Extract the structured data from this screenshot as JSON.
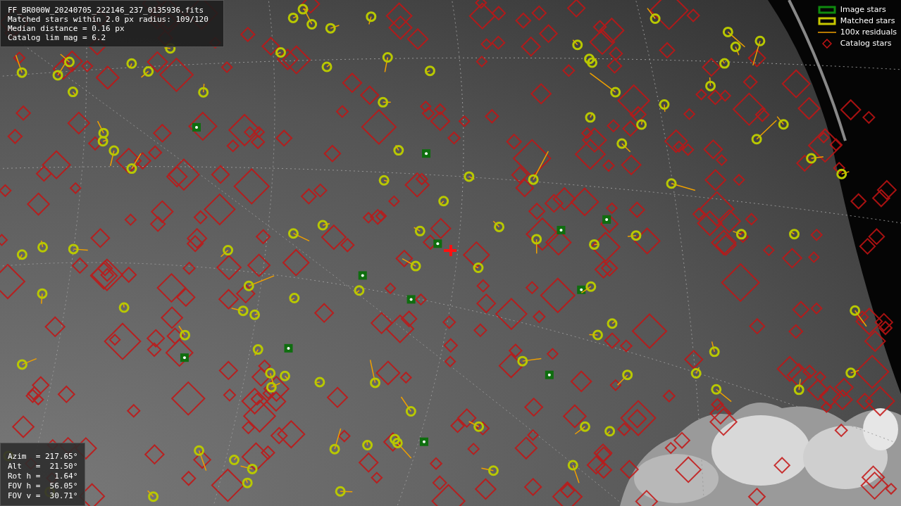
{
  "info_box": {
    "lines": [
      "FF_BR000W_20240705_222146_237_0135936.fits",
      "Matched stars within 2.0 px radius: 109/120",
      "Median distance = 0.16 px",
      "Catalog lim mag = 6.2"
    ]
  },
  "legend": [
    {
      "label": "Image stars"
    },
    {
      "kind": "matched",
      "label": "Matched stars"
    },
    {
      "kind": "residual",
      "label": "100x residuals"
    },
    {
      "kind": "catalog",
      "label": "Catalog stars"
    }
  ],
  "pointing_box": {
    "lines": [
      "Azim  = 217.65°",
      "Alt   =  21.50°",
      "Rot h =   1.64°",
      "FOV h =  56.05°",
      "FOV v =  30.71°"
    ]
  }
}
